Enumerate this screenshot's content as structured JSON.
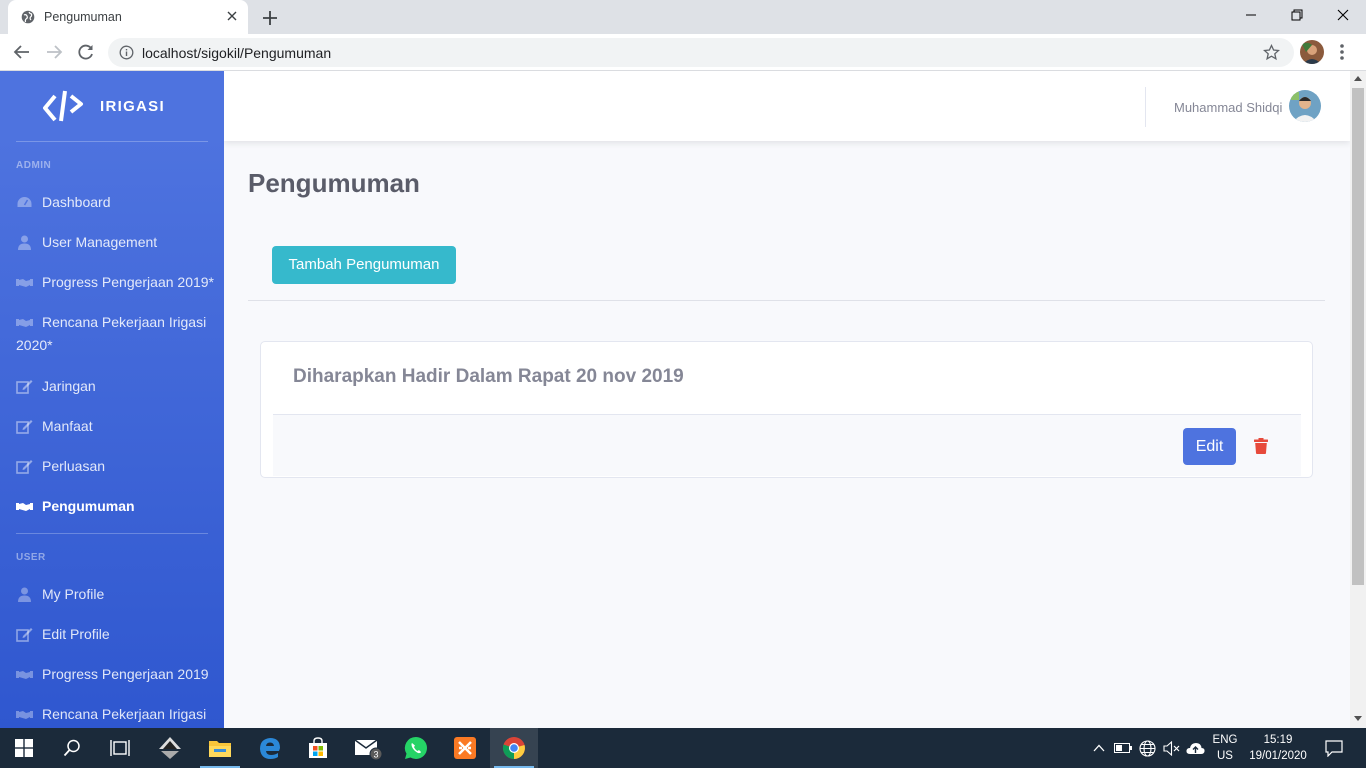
{
  "browser": {
    "tab_title": "Pengumuman",
    "url": "localhost/sigokil/Pengumuman"
  },
  "sidebar": {
    "brand": "IRIGASI",
    "sections": [
      {
        "heading": "ADMIN",
        "items": [
          {
            "label": "Dashboard",
            "icon": "tachometer-icon"
          },
          {
            "label": "User Management",
            "icon": "user-icon"
          },
          {
            "label": "Progress Pengerjaan 2019*",
            "icon": "handshake-icon"
          },
          {
            "label": "Rencana Pekerjaan Irigasi 2020*",
            "icon": "handshake-icon"
          },
          {
            "label": "Jaringan",
            "icon": "edit-icon"
          },
          {
            "label": "Manfaat",
            "icon": "edit-icon"
          },
          {
            "label": "Perluasan",
            "icon": "edit-icon"
          },
          {
            "label": "Pengumuman",
            "icon": "handshake-icon",
            "active": true
          }
        ]
      },
      {
        "heading": "USER",
        "items": [
          {
            "label": "My Profile",
            "icon": "user-icon"
          },
          {
            "label": "Edit Profile",
            "icon": "edit-icon"
          },
          {
            "label": "Progress Pengerjaan 2019",
            "icon": "handshake-icon"
          },
          {
            "label": "Rencana Pekerjaan Irigasi",
            "icon": "handshake-icon"
          }
        ]
      }
    ]
  },
  "topbar": {
    "username": "Muhammad Shidqi"
  },
  "main": {
    "page_title": "Pengumuman",
    "add_button": "Tambah Pengumuman",
    "announcements": [
      {
        "title": "Diharapkan Hadir Dalam Rapat 20 nov 2019",
        "edit_label": "Edit"
      }
    ]
  },
  "taskbar": {
    "mail_badge": "3",
    "language": "ENG",
    "region": "US",
    "time": "15:19",
    "date": "19/01/2020"
  },
  "colors": {
    "sidebar": "#4e73df",
    "info_button": "#36b9cc",
    "primary_button": "#4e73df",
    "danger": "#e74a3b"
  }
}
